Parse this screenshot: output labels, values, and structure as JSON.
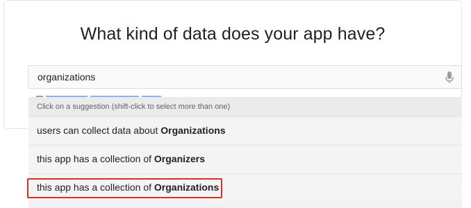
{
  "dialog": {
    "title": "What kind of data does your app have?"
  },
  "search": {
    "value": "organizations",
    "mic_icon": "microphone-icon"
  },
  "suggestions": {
    "header": "Click on a suggestion (shift-click to select more than one)",
    "items": [
      {
        "prefix": "users can collect data about ",
        "bold": "Organizations"
      },
      {
        "prefix": "this app has a collection of ",
        "bold": "Organizers"
      },
      {
        "prefix": "this app has a collection of ",
        "bold": "Organizations"
      }
    ]
  },
  "colors": {
    "highlight": "#d93025",
    "dropdown_bg": "#f1f1f1",
    "text": "#202124"
  }
}
